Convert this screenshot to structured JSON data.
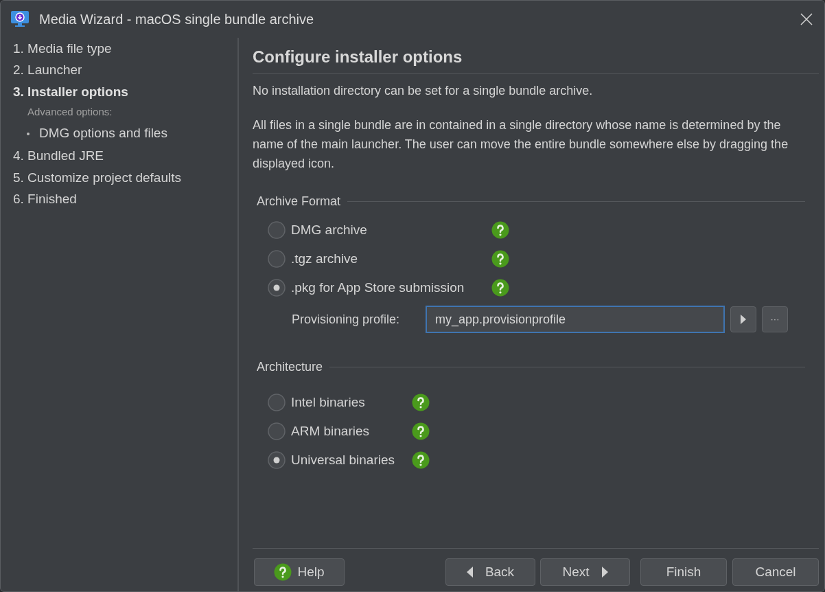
{
  "window": {
    "title": "Media Wizard - macOS single bundle archive"
  },
  "steps": [
    {
      "kind": "step",
      "label": "1. Media file type",
      "selected": false
    },
    {
      "kind": "step",
      "label": "2. Launcher",
      "selected": false
    },
    {
      "kind": "step",
      "label": "3. Installer options",
      "selected": true
    },
    {
      "kind": "subheading",
      "label": "Advanced options:",
      "selected": false
    },
    {
      "kind": "subitem",
      "label": "DMG options and files",
      "selected": false
    },
    {
      "kind": "step",
      "label": "4. Bundled JRE",
      "selected": false
    },
    {
      "kind": "step",
      "label": "5. Customize project defaults",
      "selected": false
    },
    {
      "kind": "step",
      "label": "6. Finished",
      "selected": false
    }
  ],
  "heading": "Configure installer options",
  "paragraphs": [
    "No installation directory can be set for a single bundle archive.",
    "All files in a single bundle are in contained in a single directory whose name is determined by the name of the main launcher. The user can move the entire bundle somewhere else by dragging the displayed icon."
  ],
  "archive_format": {
    "title": "Archive Format",
    "options": [
      {
        "label": "DMG archive",
        "selected": false
      },
      {
        "label": ".tgz archive",
        "selected": false
      },
      {
        "label": ".pkg for App Store submission",
        "selected": true
      }
    ],
    "provisioning_profile": {
      "label": "Provisioning profile:",
      "value": "my_app.provisionprofile",
      "browse": "···"
    }
  },
  "architecture": {
    "title": "Architecture",
    "options": [
      {
        "label": "Intel binaries",
        "selected": false
      },
      {
        "label": "ARM binaries",
        "selected": false
      },
      {
        "label": "Universal binaries",
        "selected": true
      }
    ]
  },
  "buttons": {
    "help": "Help",
    "back": "Back",
    "next": "Next",
    "finish": "Finish",
    "cancel": "Cancel"
  }
}
